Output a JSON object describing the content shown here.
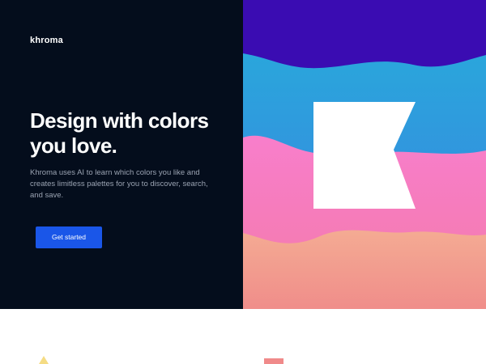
{
  "brand": {
    "logo_text": "khroma"
  },
  "hero": {
    "headline": "Design with colors you love.",
    "description": "Khroma uses AI to learn which colors you like and creates limitless palettes for you to discover, search, and save.",
    "cta_label": "Get started"
  },
  "colors": {
    "background_dark": "#040d1c",
    "cta": "#1a56e8",
    "wave_purple": "#3b0db3",
    "wave_blue": "#2b8fdc",
    "wave_pink": "#f47fc6",
    "wave_coral": "#f2a392"
  },
  "icons": {
    "hero_mark": "khroma-k-logo-icon",
    "feature_one": "triangle-icon",
    "feature_two": "bar-icon"
  }
}
